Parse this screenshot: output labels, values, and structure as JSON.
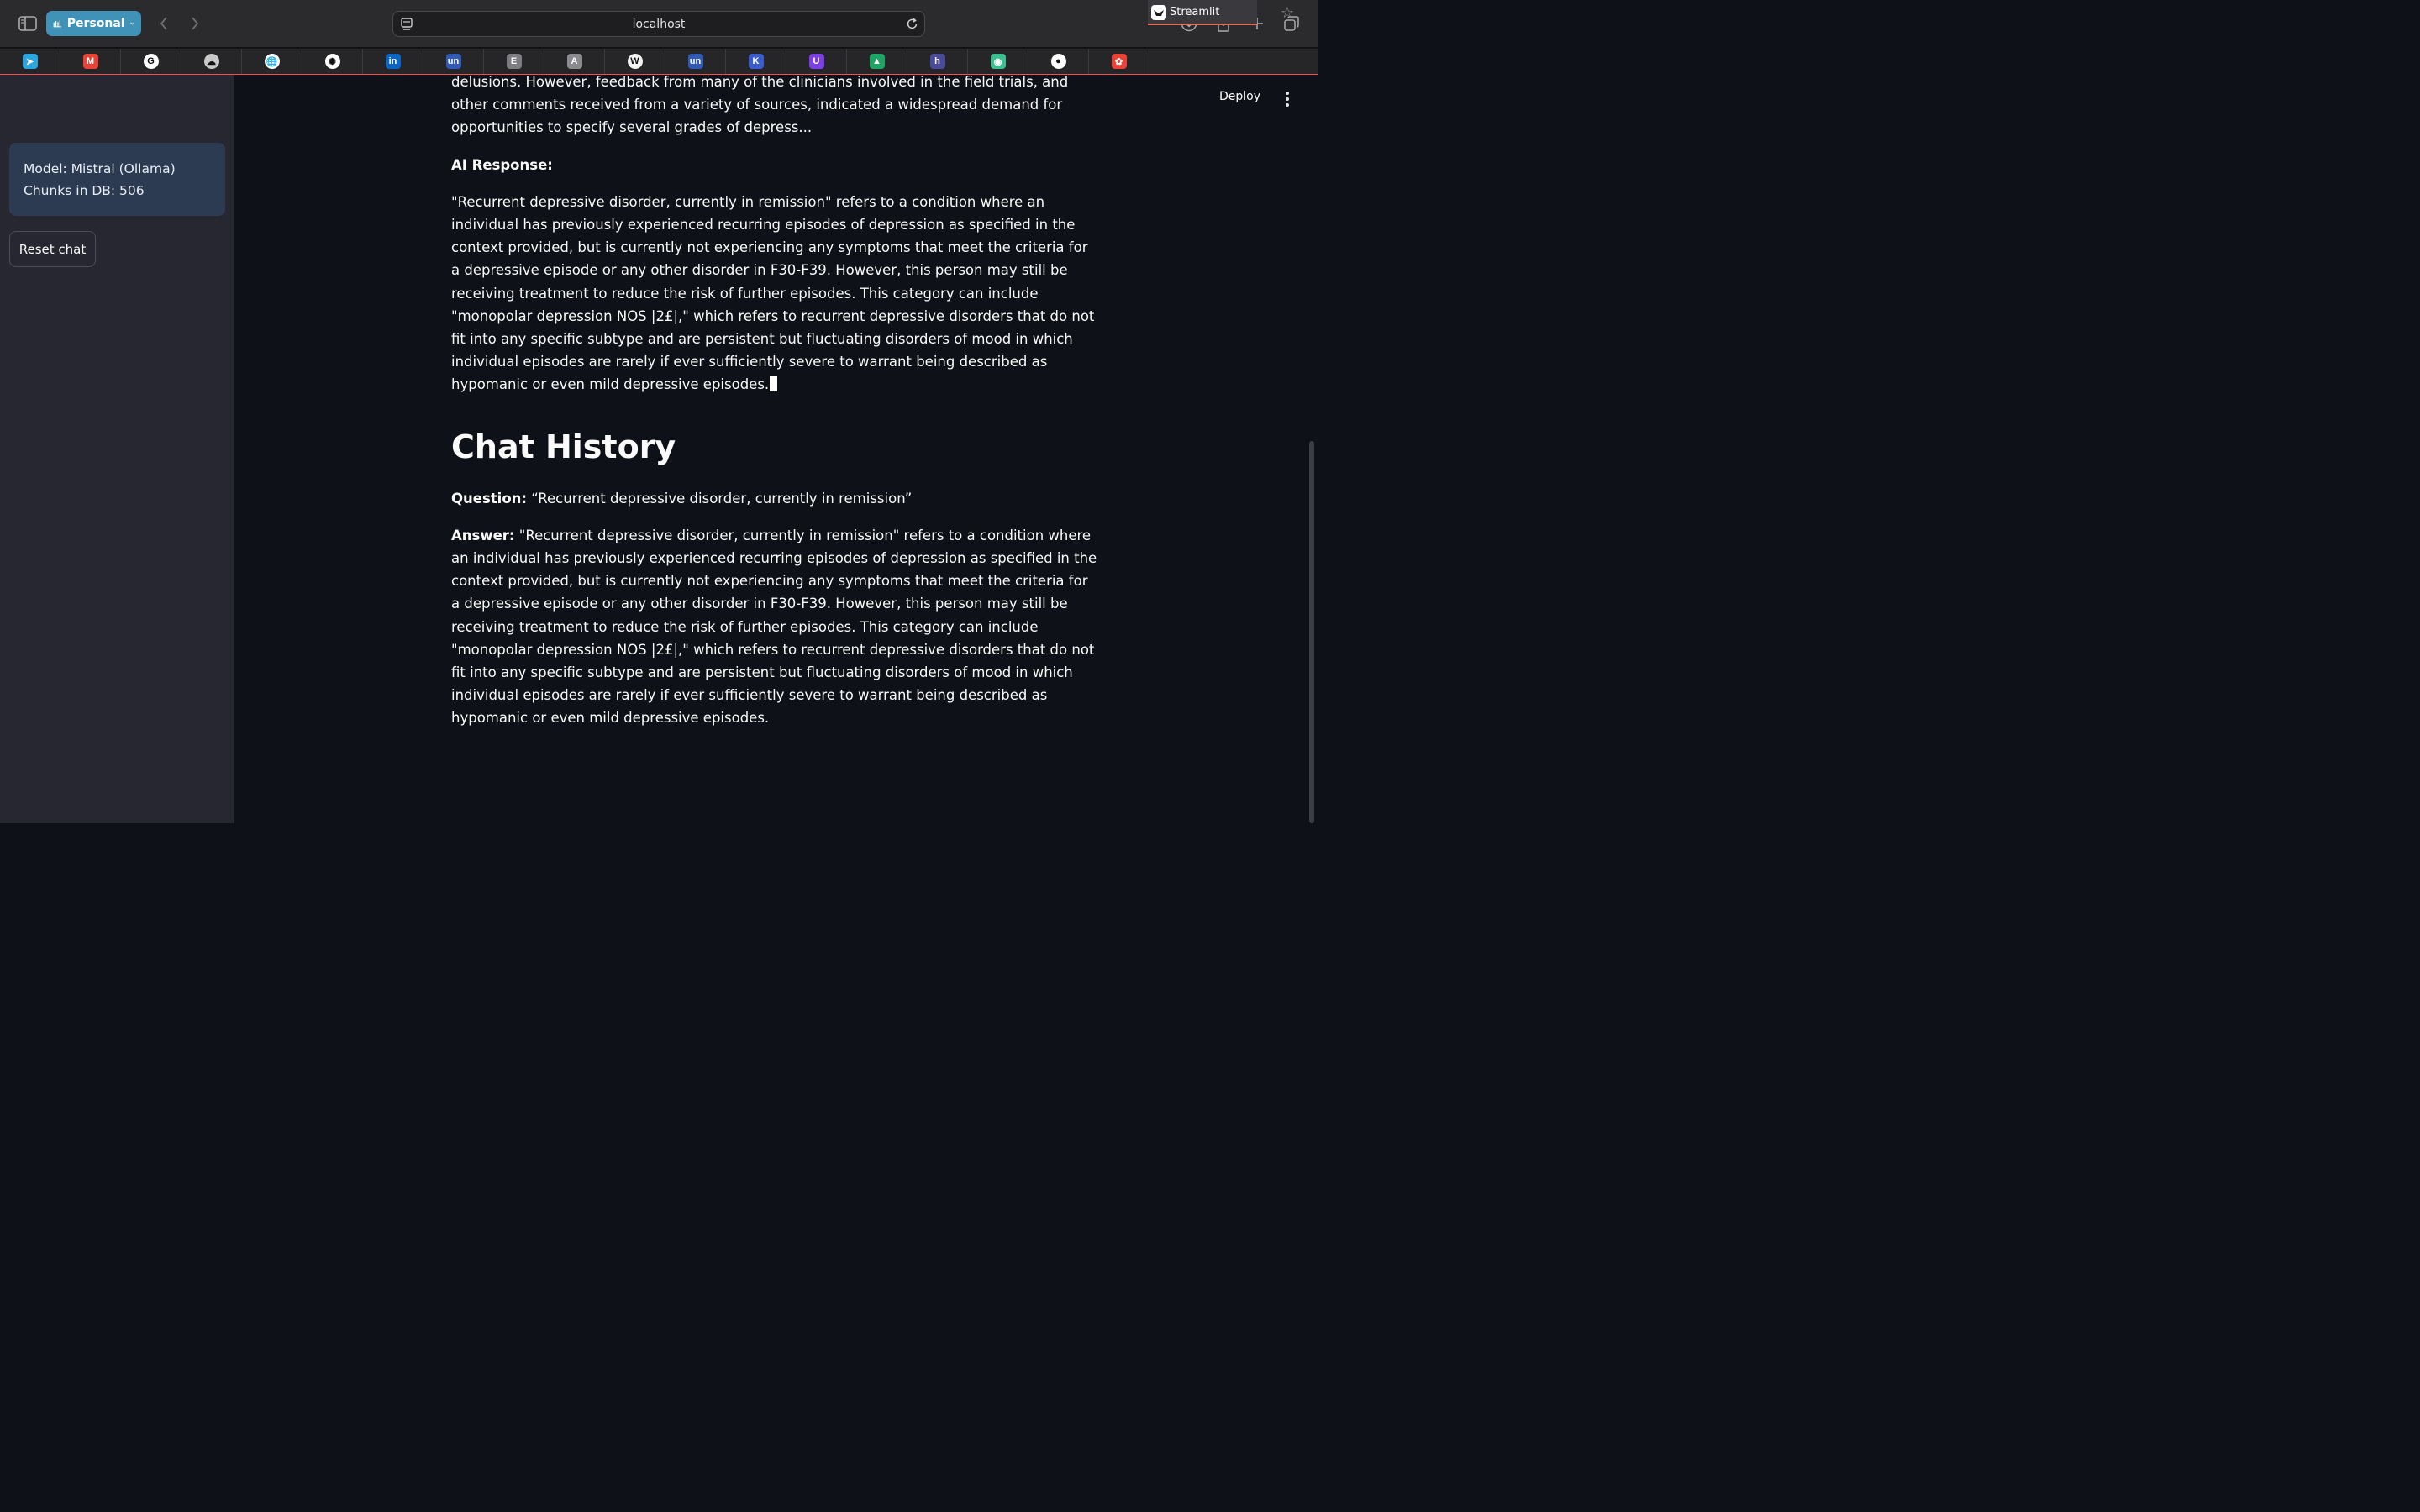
{
  "browser": {
    "profile_label": "Personal",
    "url": "localhost",
    "active_tab": "Streamlit",
    "bookmarks": [
      {
        "icon": "telegram-icon",
        "color": "#2ca5e0",
        "glyph": "➤"
      },
      {
        "icon": "gmail-icon",
        "color": "#ea4335",
        "glyph": "M"
      },
      {
        "icon": "google-icon",
        "color": "#ffffff",
        "glyph": "G"
      },
      {
        "icon": "cloud-icon",
        "color": "#c9c9c9",
        "glyph": "☁"
      },
      {
        "icon": "globe-icon",
        "color": "#ffffff",
        "glyph": "🌐"
      },
      {
        "icon": "openai-icon",
        "color": "#ffffff",
        "glyph": "✺"
      },
      {
        "icon": "linkedin-icon",
        "color": "#0a66c2",
        "glyph": "in"
      },
      {
        "icon": "unstop-icon",
        "color": "#2f5bb7",
        "glyph": "un"
      },
      {
        "icon": "e-icon",
        "color": "#7d7d82",
        "glyph": "E"
      },
      {
        "icon": "a-icon",
        "color": "#8a8a8f",
        "glyph": "A"
      },
      {
        "icon": "w-icon",
        "color": "#f2f2f2",
        "glyph": "W"
      },
      {
        "icon": "unstop-icon",
        "color": "#2f5bb7",
        "glyph": "un"
      },
      {
        "icon": "kaggle-icon",
        "color": "#3a5ccc",
        "glyph": "K"
      },
      {
        "icon": "u-icon",
        "color": "#7b3fe4",
        "glyph": "U"
      },
      {
        "icon": "drive-icon",
        "color": "#1fa463",
        "glyph": "▲"
      },
      {
        "icon": "h-icon",
        "color": "#4a4a9a",
        "glyph": "h"
      },
      {
        "icon": "chat-icon",
        "color": "#3dbf8f",
        "glyph": "◉"
      },
      {
        "icon": "github-icon",
        "color": "#ffffff",
        "glyph": "●"
      },
      {
        "icon": "photos-icon",
        "color": "#ea4335",
        "glyph": "✿"
      }
    ]
  },
  "sidebar": {
    "model_line": "Model: Mistral (Ollama)",
    "chunks_line": "Chunks in DB: 506",
    "reset_label": "Reset chat"
  },
  "header": {
    "deploy_label": "Deploy"
  },
  "main": {
    "context_tail": "delusions. However, feedback from many of the clinicians involved in the field trials, and other comments received from a variety of sources, indicated a widespread demand for opportunities to specify several grades of depress...",
    "ai_response_label": "AI Response:",
    "ai_response_text": "\"Recurrent depressive disorder, currently in remission\" refers to a condition where an individual has previously experienced recurring episodes of depression as specified in the context provided, but is currently not experiencing any symptoms that meet the criteria for a depressive episode or any other disorder in F30-F39. However, this person may still be receiving treatment to reduce the risk of further episodes. This category can include \"monopolar depression NOS |2£|,\" which refers to recurrent depressive disorders that do not fit into any specific subtype and are persistent but fluctuating disorders of mood in which individual episodes are rarely if ever sufficiently severe to warrant being described as hypomanic or even mild depressive episodes.",
    "history_title": "Chat History",
    "question_label": "Question:",
    "question_text": "“Recurrent depressive disorder, currently in remission”",
    "answer_label": "Answer:",
    "answer_text": "\"Recurrent depressive disorder, currently in remission\" refers to a condition where an individual has previously experienced recurring episodes of depression as specified in the context provided, but is currently not experiencing any symptoms that meet the criteria for a depressive episode or any other disorder in F30-F39. However, this person may still be receiving treatment to reduce the risk of further episodes. This category can include \"monopolar depression NOS |2£|,\" which refers to recurrent depressive disorders that do not fit into any specific subtype and are persistent but fluctuating disorders of mood in which individual episodes are rarely if ever sufficiently severe to warrant being described as hypomanic or even mild depressive episodes."
  }
}
